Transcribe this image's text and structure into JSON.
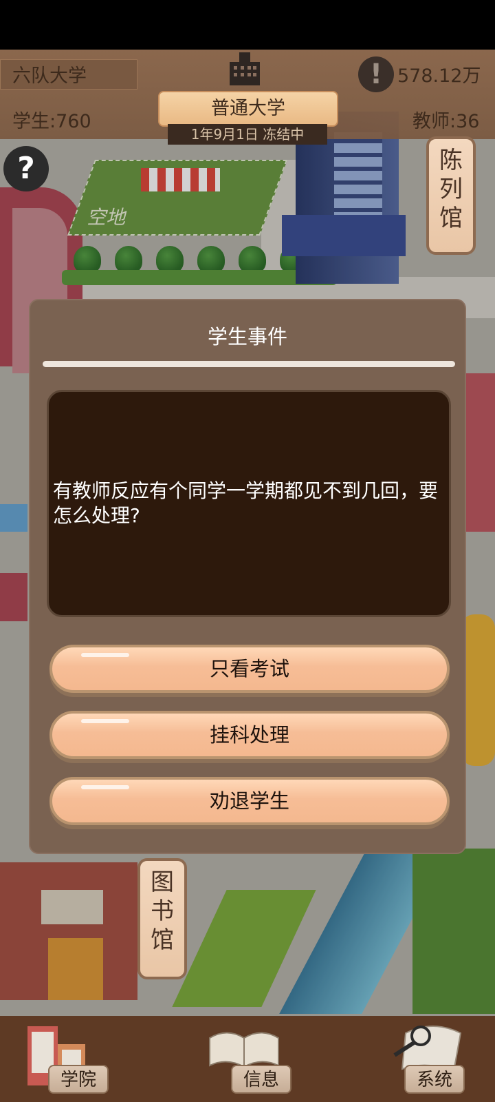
{
  "hud": {
    "school_name": "六队大学",
    "money": "578.12万",
    "students": "学生:760",
    "teachers": "教师:36",
    "school_rank": "普通大学",
    "date_status": "1年9月1日 冻结中",
    "help_symbol": "?",
    "alert_symbol": "!"
  },
  "map": {
    "empty_lot_label": "空地",
    "sign_exhibition": [
      "陈",
      "列",
      "馆"
    ],
    "sign_library": [
      "图",
      "书",
      "馆"
    ]
  },
  "modal": {
    "title": "学生事件",
    "message": "有教师反应有个同学一学期都见不到几回，要怎么处理?",
    "choices": [
      {
        "label": "只看考试"
      },
      {
        "label": "挂科处理"
      },
      {
        "label": "劝退学生"
      }
    ]
  },
  "nav": {
    "items": [
      {
        "label": "学院",
        "icon": "college-building-icon"
      },
      {
        "label": "信息",
        "icon": "book-icon"
      },
      {
        "label": "系统",
        "icon": "scroll-magnifier-icon"
      }
    ]
  },
  "colors": {
    "modal_bg": "#7a6251",
    "message_bg": "#2d190c",
    "button_fill": "#f6bd96",
    "nav_bg": "#5e3a24"
  }
}
